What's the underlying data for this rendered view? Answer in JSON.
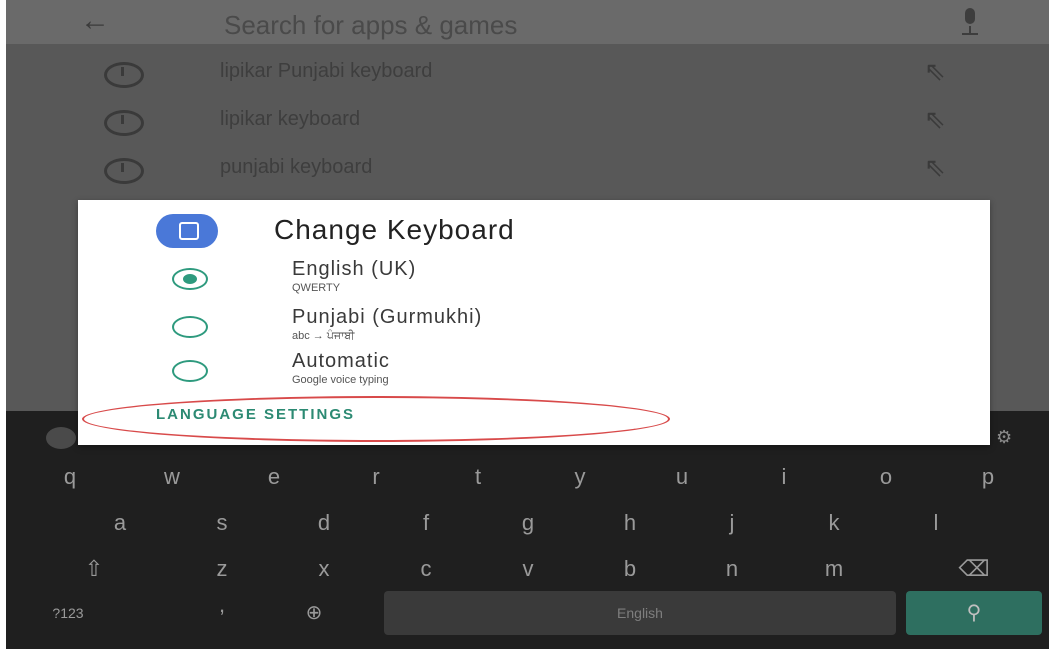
{
  "search": {
    "placeholder": "Search for apps & games"
  },
  "history": [
    {
      "term": "lipikar Punjabi keyboard"
    },
    {
      "term": "lipikar keyboard"
    },
    {
      "term": "punjabi keyboard"
    }
  ],
  "dialog": {
    "title": "Change Keyboard",
    "options": [
      {
        "name": "English (UK)",
        "sub": "QWERTY",
        "selected": true
      },
      {
        "name": "Punjabi (Gurmukhi)",
        "sub": "abc → ਪੰਜਾਬੀ",
        "selected": false
      },
      {
        "name": "Automatic",
        "sub": "Google voice typing",
        "selected": false
      }
    ],
    "settings_label": "LANGUAGE SETTINGS"
  },
  "keyboard": {
    "row1": [
      "q",
      "w",
      "e",
      "r",
      "t",
      "y",
      "u",
      "i",
      "o",
      "p"
    ],
    "row2": [
      "a",
      "s",
      "d",
      "f",
      "g",
      "h",
      "j",
      "k",
      "l"
    ],
    "row3": [
      "z",
      "x",
      "c",
      "v",
      "b",
      "n",
      "m"
    ],
    "symbols_label": "?123",
    "comma_label": ",",
    "space_label": "English",
    "enter_label": "⚲"
  }
}
